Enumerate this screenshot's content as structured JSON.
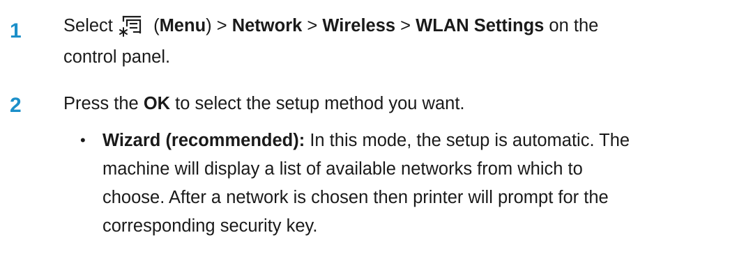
{
  "step1": {
    "number": "1",
    "select": "Select",
    "open_paren": "(",
    "menu": "Menu",
    "close_sep": ") >",
    "network": "Network",
    "sep2": ">",
    "wireless": "Wireless",
    "sep3": ">",
    "wlan": "WLAN Settings",
    "tail1": "on the",
    "line2": "control panel.",
    "icon": "menu-icon"
  },
  "step2": {
    "number": "2",
    "press_the": "Press the",
    "ok": "OK",
    "rest": "to select the setup method you want."
  },
  "bullet": {
    "marker": "•",
    "title": "Wizard (recommended):",
    "line1": "In this mode, the setup is automatic. The",
    "line2": "machine will display a list of available networks from which to",
    "line3": "choose. After a network is chosen then printer will prompt for the",
    "line4": "corresponding security key."
  },
  "colors": {
    "step_number": "#1b8fc9",
    "text": "#1a1a1a"
  }
}
